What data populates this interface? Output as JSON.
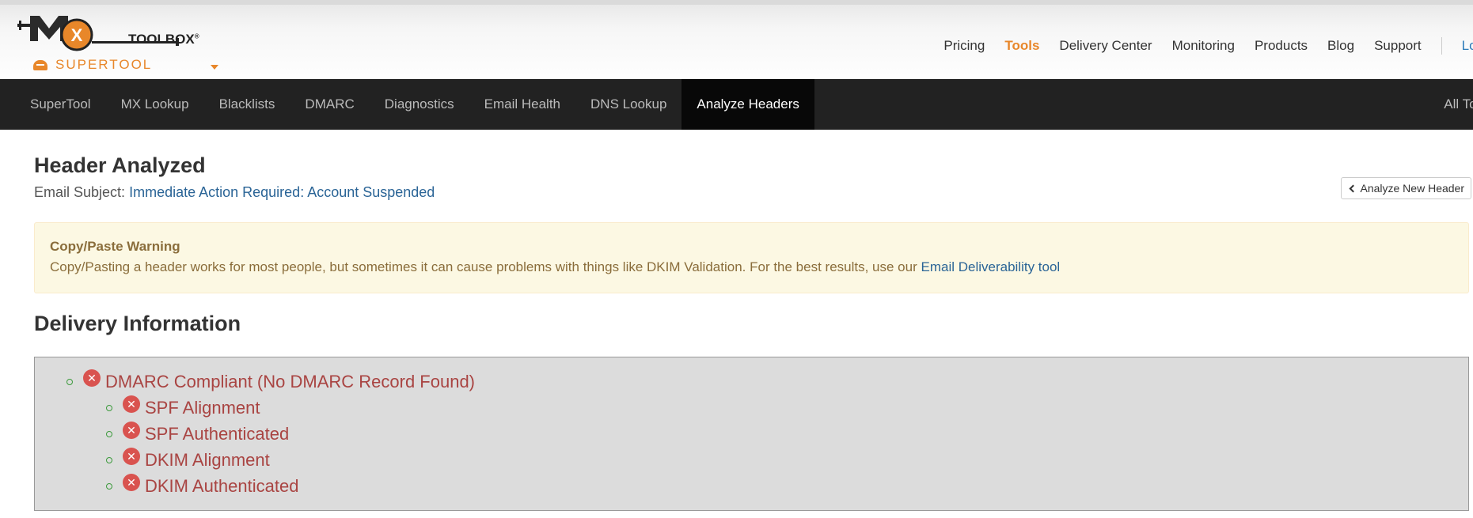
{
  "header": {
    "logo": {
      "brand_mx": "MX",
      "brand_toolbox": "TOOLBOX",
      "registered": "®",
      "product": "SUPERTOOL"
    },
    "nav": [
      {
        "label": "Pricing",
        "active": false
      },
      {
        "label": "Tools",
        "active": true
      },
      {
        "label": "Delivery Center",
        "active": false
      },
      {
        "label": "Monitoring",
        "active": false
      },
      {
        "label": "Products",
        "active": false
      },
      {
        "label": "Blog",
        "active": false
      },
      {
        "label": "Support",
        "active": false
      }
    ],
    "login_label": "Log"
  },
  "tool_nav": {
    "items": [
      {
        "label": "SuperTool",
        "active": false
      },
      {
        "label": "MX Lookup",
        "active": false
      },
      {
        "label": "Blacklists",
        "active": false
      },
      {
        "label": "DMARC",
        "active": false
      },
      {
        "label": "Diagnostics",
        "active": false
      },
      {
        "label": "Email Health",
        "active": false
      },
      {
        "label": "DNS Lookup",
        "active": false
      },
      {
        "label": "Analyze Headers",
        "active": true
      }
    ],
    "all_tools_label": "All Too"
  },
  "main": {
    "title": "Header Analyzed",
    "subject_label": "Email Subject:",
    "subject_value": "Immediate Action Required: Account Suspended",
    "analyze_new_button": "Analyze New Header",
    "warning": {
      "title": "Copy/Paste Warning",
      "text": "Copy/Pasting a header works for most people, but sometimes it can cause problems with things like DKIM Validation. For the best results, use our ",
      "link": "Email Deliverability tool"
    },
    "delivery_title": "Delivery Information",
    "delivery_items": [
      {
        "label": "DMARC Compliant (No DMARC Record Found)",
        "status": "fail",
        "level": 1
      },
      {
        "label": "SPF Alignment",
        "status": "fail",
        "level": 2
      },
      {
        "label": "SPF Authenticated",
        "status": "fail",
        "level": 2
      },
      {
        "label": "DKIM Alignment",
        "status": "fail",
        "level": 2
      },
      {
        "label": "DKIM Authenticated",
        "status": "fail",
        "level": 2
      }
    ]
  },
  "colors": {
    "accent_orange": "#e8872a",
    "nav_dark": "#222222",
    "link_blue": "#2a6496",
    "fail_red": "#d9534f",
    "fail_text": "#a94442",
    "warning_bg": "#fcf8e3"
  }
}
